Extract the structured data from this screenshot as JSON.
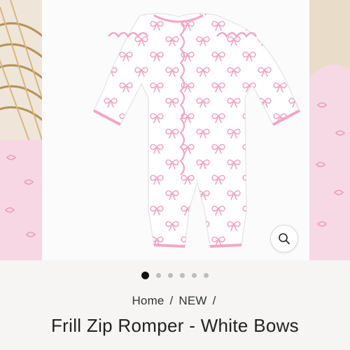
{
  "gallery": {
    "active_index": 0,
    "slide_count": 6,
    "zoom_icon": "search-icon",
    "colors": {
      "bow_pink": "#f2a6c4",
      "romper_white": "#ffffff",
      "basket_tan": "#c9a56e"
    }
  },
  "breadcrumb": {
    "items": [
      "Home",
      "NEW"
    ],
    "separator": "/"
  },
  "product": {
    "title": "Frill Zip Romper - White Bows"
  }
}
